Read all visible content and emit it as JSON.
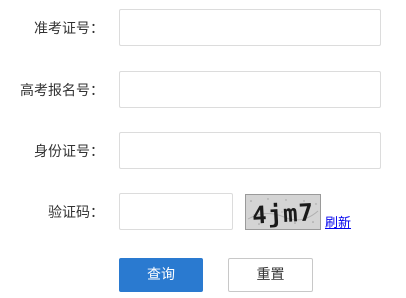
{
  "form": {
    "exam_id": {
      "label": "准考证号：",
      "value": "",
      "placeholder": ""
    },
    "gaokao_id": {
      "label": "高考报名号：",
      "value": "",
      "placeholder": ""
    },
    "id_card": {
      "label": "身份证号：",
      "value": "",
      "placeholder": ""
    },
    "captcha": {
      "label": "验证码：",
      "value": "",
      "placeholder": "",
      "image_text": "4jm7",
      "refresh_label": "刷新"
    }
  },
  "buttons": {
    "query_label": "查询",
    "reset_label": "重置"
  },
  "colors": {
    "primary": "#2a7ad0",
    "border": "#dcdcdc",
    "link": "#0000ee"
  }
}
